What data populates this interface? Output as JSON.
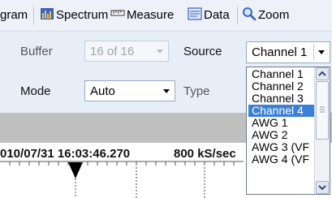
{
  "toolbar": {
    "items": [
      {
        "label": "gram",
        "icon": ""
      },
      {
        "label": "Spectrum",
        "icon": "spectrum-icon"
      },
      {
        "label": "Measure",
        "icon": "measure-icon"
      },
      {
        "label": "Data",
        "icon": "data-icon"
      },
      {
        "label": "Zoom",
        "icon": "zoom-icon"
      }
    ]
  },
  "settings": {
    "buffer_label": "Buffer",
    "buffer_value": "16 of 16",
    "source_label": "Source",
    "source_value": "Channel 1",
    "mode_label": "Mode",
    "mode_value": "Auto",
    "type_label": "Type"
  },
  "source_dropdown": {
    "options": [
      "Channel 1",
      "Channel 2",
      "Channel 3",
      "Channel 4",
      "AWG 1",
      "AWG 2",
      "AWG 3 (VF",
      "AWG 4 (VF"
    ],
    "highlighted": "Channel 4"
  },
  "status": {
    "datetime": "010/07/31 16:03:46.270",
    "sample_rate": "800 kS/sec"
  },
  "colors": {
    "toolbar_bg": "#eef2f8",
    "panel_bg": "#e8eef7",
    "selection": "#3c7fd6",
    "band": "#c0c0c0"
  }
}
